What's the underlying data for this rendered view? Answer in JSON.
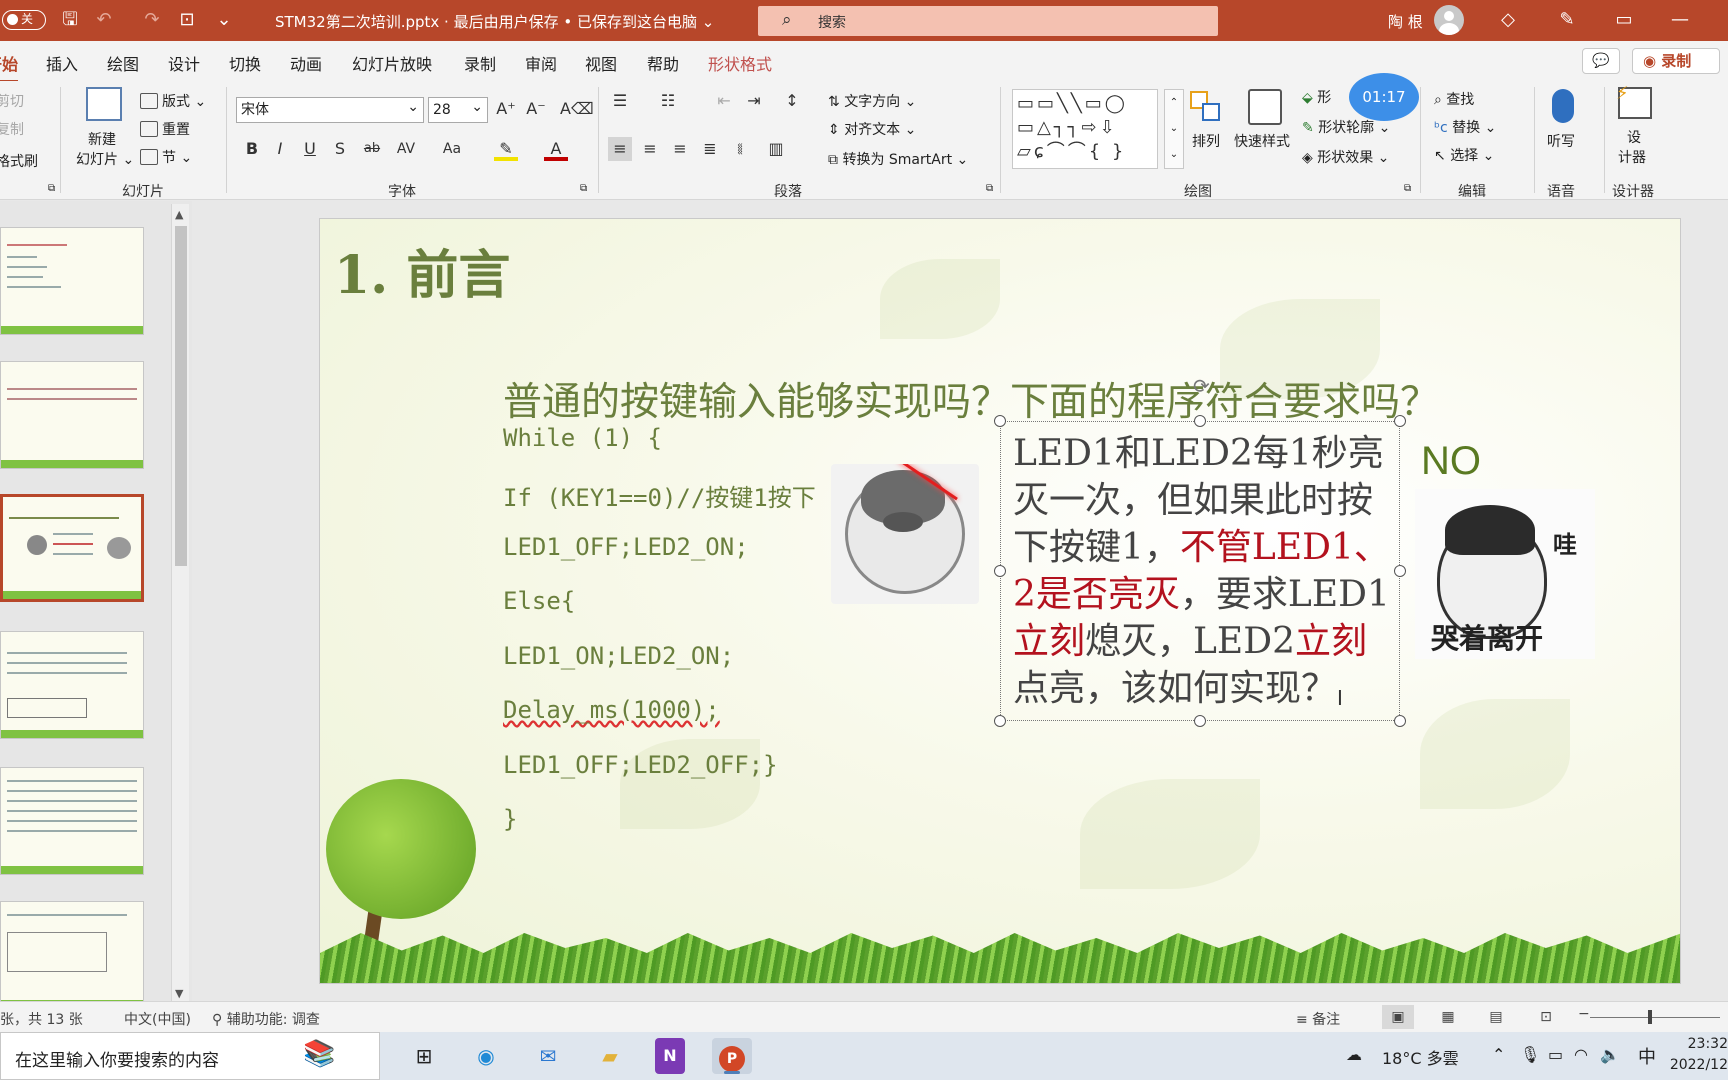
{
  "titlebar": {
    "autosave_label": "关",
    "doc_title": "STM32第二次培训.pptx  ·  最后由用户保存 • 已保存到这台电脑 ⌄",
    "search_placeholder": "搜索",
    "user_name": "陶 根",
    "colors": {
      "accent": "#b7472a",
      "search_bg": "#f4c1b1"
    },
    "icons": [
      "save-icon",
      "undo-icon",
      "redo-icon",
      "present-icon",
      "customize-icon",
      "diamond-icon",
      "pen-icon",
      "restore-icon",
      "minimize-icon"
    ]
  },
  "tabs": [
    {
      "label": "开始",
      "active": true
    },
    {
      "label": "插入"
    },
    {
      "label": "绘图"
    },
    {
      "label": "设计"
    },
    {
      "label": "切换"
    },
    {
      "label": "动画"
    },
    {
      "label": "幻灯片放映"
    },
    {
      "label": "录制"
    },
    {
      "label": "审阅"
    },
    {
      "label": "视图"
    },
    {
      "label": "帮助"
    },
    {
      "label": "形状格式",
      "contextual": true
    }
  ],
  "ribbon_right": {
    "record_label": "◉ 录制",
    "comment_icon": "comment-icon"
  },
  "ribbon": {
    "clipboard": {
      "cut": "剪切",
      "copy": "复制",
      "format_painter": "格式刷"
    },
    "slides": {
      "label": "幻灯片",
      "new_slide": "新建",
      "new_slide_2": "幻灯片 ⌄",
      "layout": "版式 ⌄",
      "reset": "重置",
      "section": "节 ⌄"
    },
    "font": {
      "label": "字体",
      "font_name": "宋体",
      "font_size": "28",
      "buttons": [
        "B",
        "I",
        "U",
        "S",
        "ab",
        "AV",
        "Aa"
      ]
    },
    "paragraph": {
      "label": "段落",
      "text_direction": "文字方向 ⌄",
      "align_text": "对齐文本 ⌄",
      "smartart": "转换为 SmartArt ⌄"
    },
    "drawing": {
      "label": "绘图",
      "shapes_preview": "▭⬚╲╲▭◯\n▭△┐┐⇨⇩\n▱ɕ⌒⌒{ }",
      "arrange": "排列",
      "quick_styles": "快速样式",
      "shape_fill": "形",
      "shape_outline": "形状轮廓 ⌄",
      "shape_effects": "形状效果 ⌄",
      "timer": "01:17"
    },
    "editing": {
      "label": "编辑",
      "find": "查找",
      "replace": "替换 ⌄",
      "select": "选择 ⌄"
    },
    "voice": {
      "label": "语音",
      "dictate": "听写"
    },
    "designer": {
      "label": "设计器",
      "designer_btn_1": "设",
      "designer_btn_2": "计器"
    }
  },
  "slide": {
    "title": "1. 前言",
    "question": "普通的按键输入能够实现吗？下面的程序符合要求吗？",
    "code_lines": [
      "While (1) {",
      "If (KEY1==0)//按键1按下",
      "  LED1_OFF;LED2_ON;",
      "Else{",
      "LED1_ON;LED2_ON;",
      "Delay_ms(1000);",
      "LED1_OFF;LED2_OFF;}",
      "}"
    ],
    "textbox": {
      "part1": " LED1和LED2每1秒亮灭一次，但如果此时按下按键1，",
      "part2_red": "不管LED1、2是否亮灭",
      "part3": "，要求LED1",
      "part4_red": "立刻",
      "part5": "熄灭，LED2",
      "part6_red": "立刻",
      "part7": "点亮，该如何实现？"
    },
    "no_label": "NO",
    "meme2_text_top": "哇",
    "meme2_text_bottom": "哭着离开",
    "colors": {
      "title": "#6a7f3d",
      "emphasis_red": "#b3121e"
    }
  },
  "statusbar": {
    "slide_info": "张，共 13 张",
    "language": "中文(中国)",
    "accessibility": "辅助功能: 调查",
    "notes": "≡ 备注"
  },
  "taskbar": {
    "search_placeholder": "在这里输入你要搜索的内容",
    "weather": "18°C 多雲",
    "ime": "中",
    "time": "23:32",
    "date": "2022/12"
  }
}
